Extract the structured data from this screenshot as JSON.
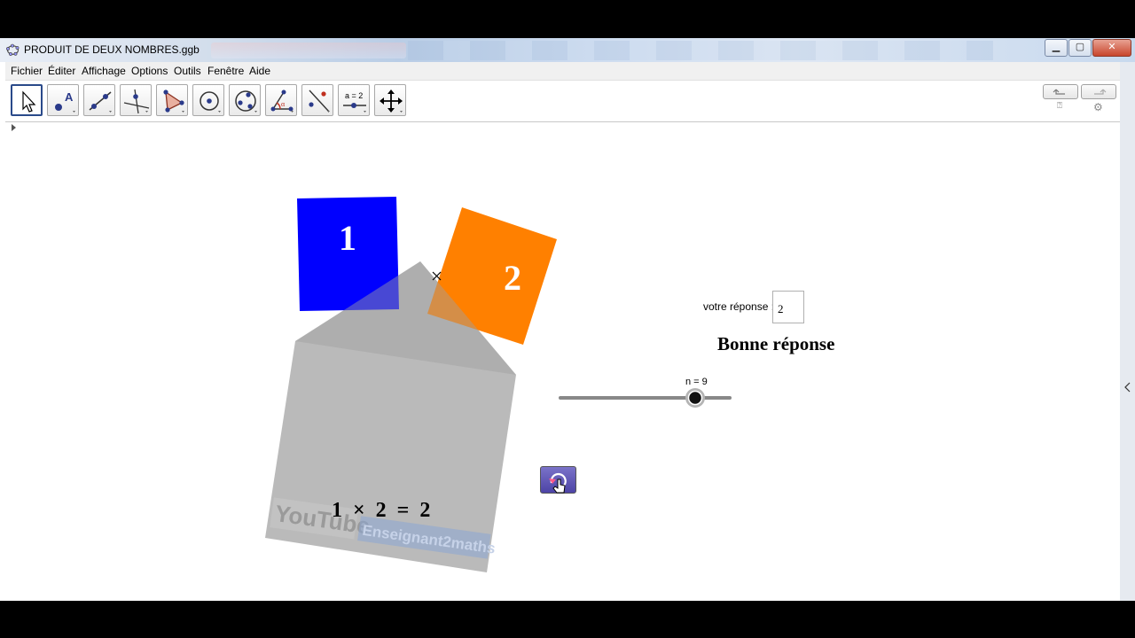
{
  "window": {
    "title": "PRODUIT DE DEUX NOMBRES.ggb",
    "buttons": {
      "minimize": "▁",
      "maximize": "▢",
      "close": "✕"
    }
  },
  "menu": [
    "Fichier",
    "Éditer",
    "Affichage",
    "Options",
    "Outils",
    "Fenêtre",
    "Aide"
  ],
  "toolbar": {
    "tools": [
      {
        "name": "move-tool",
        "icon": "pointer-icon"
      },
      {
        "name": "point-tool",
        "icon": "point-icon"
      },
      {
        "name": "line-tool",
        "icon": "line-icon"
      },
      {
        "name": "perpendicular-tool",
        "icon": "perpendicular-icon"
      },
      {
        "name": "polygon-tool",
        "icon": "polygon-icon"
      },
      {
        "name": "circle-tool",
        "icon": "circle-icon"
      },
      {
        "name": "conic-tool",
        "icon": "ellipse-icon"
      },
      {
        "name": "angle-tool",
        "icon": "angle-icon"
      },
      {
        "name": "reflect-tool",
        "icon": "reflect-icon"
      },
      {
        "name": "slider-tool",
        "icon": "slider-icon"
      },
      {
        "name": "move-view-tool",
        "icon": "move-arrows-icon"
      }
    ],
    "slider_tool_label": "a = 2",
    "undo_icon": "undo-icon",
    "redo_icon": "redo-icon",
    "help_icon": "help-icon",
    "settings_icon": "gear-icon"
  },
  "graphics": {
    "square1_label": "1",
    "square2_label": "2",
    "square1_color": "#0000ff",
    "square2_color": "#ff8000",
    "envelope_color": "#a0a0a0",
    "answer_label": "votre réponse :",
    "answer_value": "2",
    "feedback": "Bonne réponse",
    "slider": {
      "label": "n = 9",
      "value": 9
    },
    "equation": "1 × 2 = 2",
    "reset_icon": "reset-icon"
  },
  "watermark": {
    "brand": "YouTube",
    "channel": "Enseignant2maths"
  }
}
